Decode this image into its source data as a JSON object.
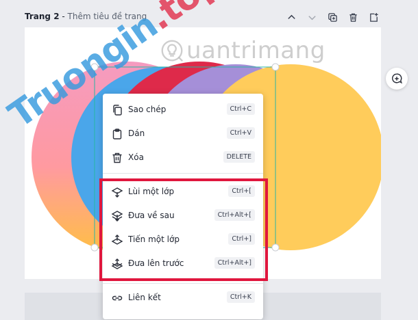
{
  "page_header": {
    "title": "Trang 2",
    "separator": " - ",
    "subtitle": "Thêm tiêu đề trang"
  },
  "toolbar": {
    "icons": [
      "chevron-up-icon",
      "chevron-down-icon",
      "duplicate-icon",
      "trash-icon",
      "add-page-icon"
    ]
  },
  "canvas": {
    "background": "#ffffff",
    "shape_colors": [
      "#f59bc0",
      "#4aa6ea",
      "#de2a4a",
      "#a58fd8",
      "#ffcc5b"
    ]
  },
  "watermarks": {
    "left_main": "Truongin",
    "left_suffix": ".top",
    "right": "uantrimang"
  },
  "context_menu": {
    "items": [
      {
        "label": "Sao chép",
        "shortcut": "Ctrl+C",
        "icon": "copy-icon"
      },
      {
        "label": "Dán",
        "shortcut": "Ctrl+V",
        "icon": "clipboard-icon"
      },
      {
        "label": "Xóa",
        "shortcut": "DELETE",
        "icon": "trash-icon"
      },
      {
        "label": "Lùi một lớp",
        "shortcut": "Ctrl+[",
        "icon": "layer-backward-icon"
      },
      {
        "label": "Đưa về sau",
        "shortcut": "Ctrl+Alt+[",
        "icon": "layer-to-back-icon"
      },
      {
        "label": "Tiến một lớp",
        "shortcut": "Ctrl+]",
        "icon": "layer-forward-icon"
      },
      {
        "label": "Đưa lên trước",
        "shortcut": "Ctrl+Alt+]",
        "icon": "layer-to-front-icon"
      },
      {
        "label": "Liên kết",
        "shortcut": "Ctrl+K",
        "icon": "link-icon"
      }
    ]
  },
  "colors": {
    "highlight": "#e0163d",
    "selection": "#27b6a4"
  }
}
